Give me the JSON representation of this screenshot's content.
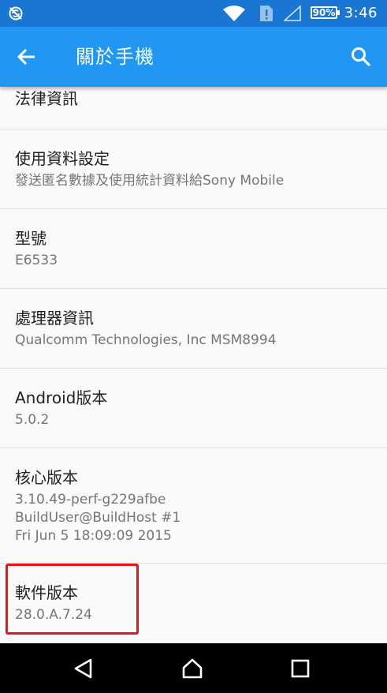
{
  "status_bar": {
    "battery_percent": "90%",
    "time": "3:46",
    "icons": [
      "sync-disabled-icon",
      "wifi-icon",
      "sim-alert-icon",
      "signal-icon",
      "battery-icon"
    ]
  },
  "app_bar": {
    "title": "關於手機",
    "back_icon": "arrow-back-icon",
    "search_icon": "search-icon"
  },
  "items": [
    {
      "title": "法律資訊",
      "subtitle": []
    },
    {
      "title": "使用資料設定",
      "subtitle": [
        "發送匿名數據及使用統計資料給Sony Mobile"
      ]
    },
    {
      "title": "型號",
      "subtitle": [
        "E6533"
      ]
    },
    {
      "title": "處理器資訊",
      "subtitle": [
        "Qualcomm Technologies, Inc MSM8994"
      ]
    },
    {
      "title": "Android版本",
      "subtitle": [
        "5.0.2"
      ]
    },
    {
      "title": "核心版本",
      "subtitle": [
        "3.10.49-perf-g229afbe",
        "BuildUser@BuildHost #1",
        "Fri Jun 5 18:09:09 2015"
      ]
    },
    {
      "title": "軟件版本",
      "subtitle": [
        "28.0.A.7.24"
      ]
    }
  ],
  "highlight_color": "#e8141a",
  "nav_bar": {
    "icons": [
      "back-triangle-icon",
      "home-circle-icon",
      "recents-square-icon"
    ]
  }
}
